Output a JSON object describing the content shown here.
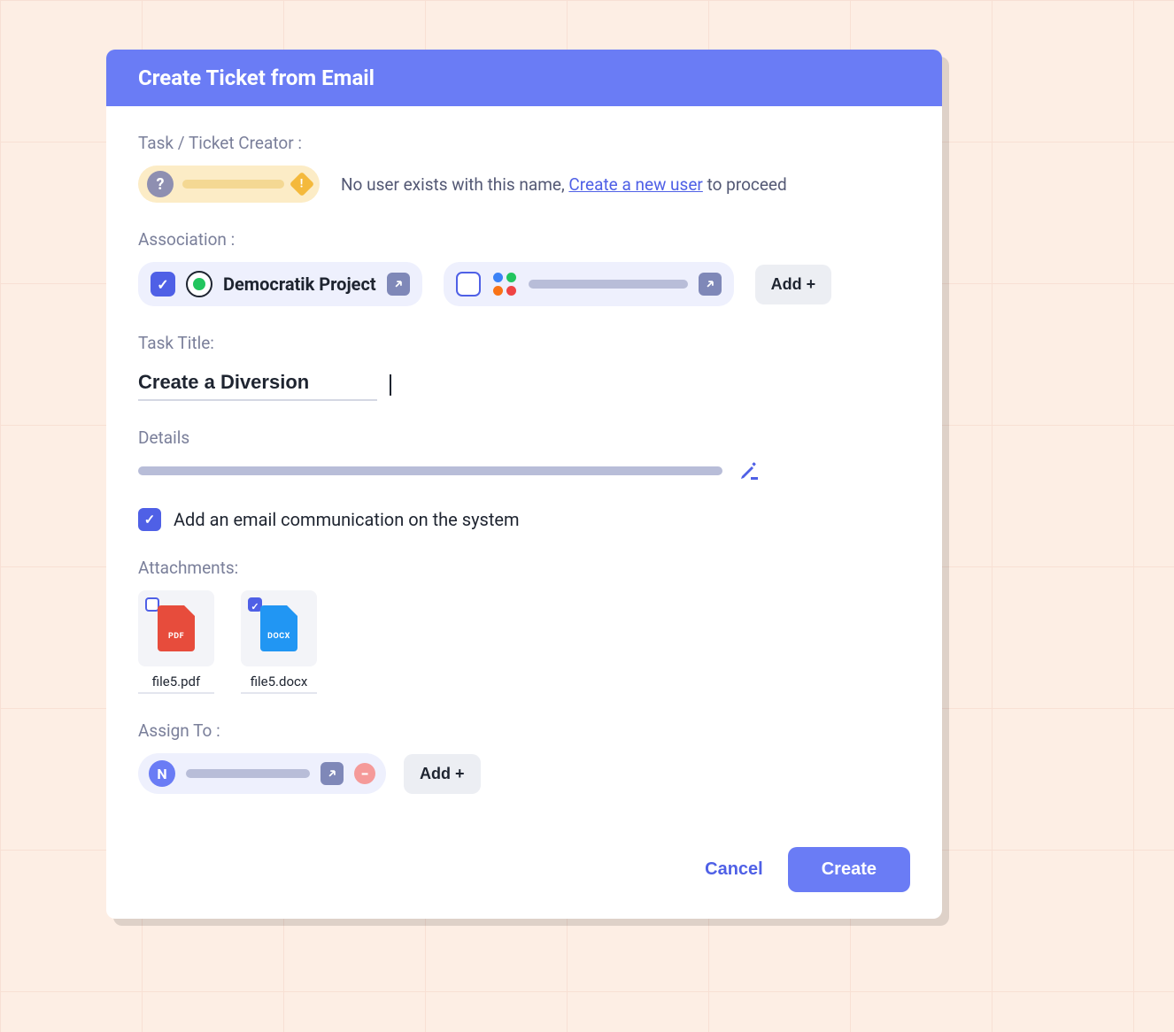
{
  "header": {
    "title": "Create Ticket from Email"
  },
  "creator": {
    "label": "Task / Ticket Creator :",
    "badge_symbol": "?",
    "warn_symbol": "!",
    "message_prefix": "No user exists with this name, ",
    "link_text": "Create a new user",
    "message_suffix": " to proceed"
  },
  "association": {
    "label": "Association :",
    "items": [
      {
        "name": "Democratik Project",
        "checked": true
      },
      {
        "name": "",
        "checked": false
      }
    ],
    "add_label": "Add +"
  },
  "title": {
    "label": "Task Title:",
    "value": "Create a Diversion"
  },
  "details": {
    "label": "Details"
  },
  "email_comm": {
    "checked": true,
    "label": "Add an email communication on the system"
  },
  "attachments": {
    "label": "Attachments:",
    "files": [
      {
        "name": "file5.pdf",
        "type": "PDF",
        "checked": false
      },
      {
        "name": "file5.docx",
        "type": "DOCX",
        "checked": true
      }
    ]
  },
  "assign": {
    "label": "Assign To :",
    "users": [
      {
        "initial": "N"
      }
    ],
    "add_label": "Add +",
    "remove_symbol": "−"
  },
  "footer": {
    "cancel": "Cancel",
    "create": "Create"
  }
}
